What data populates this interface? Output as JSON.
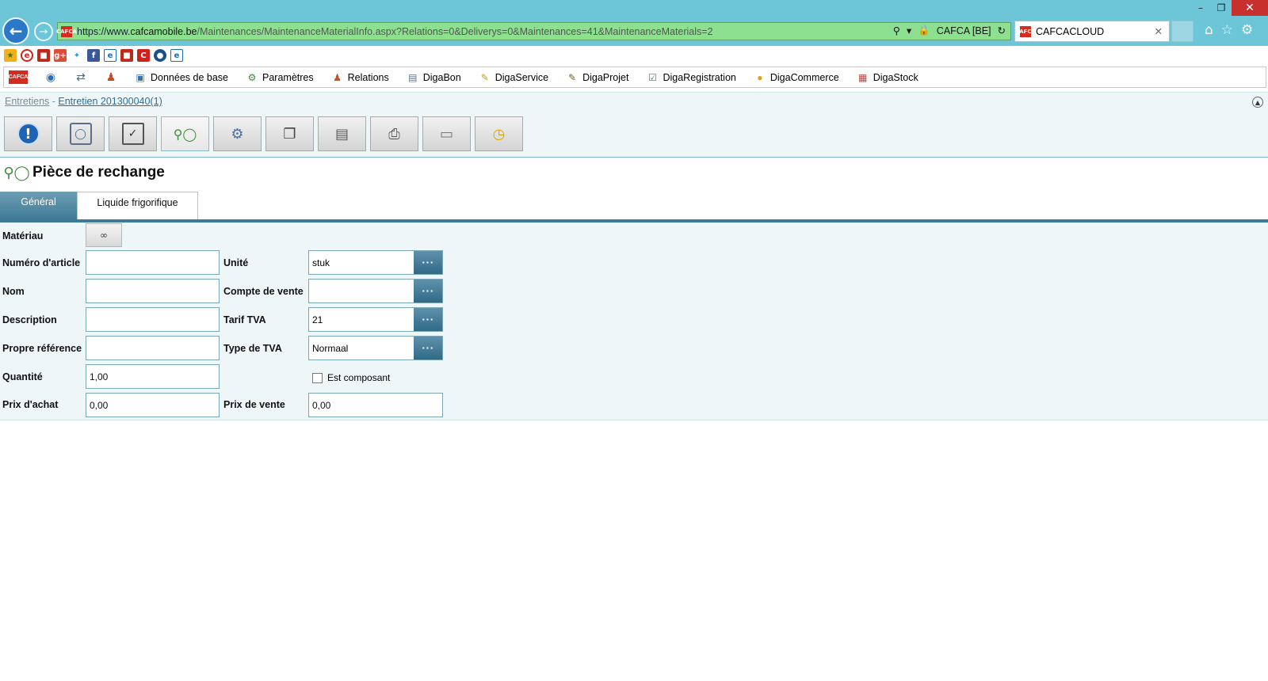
{
  "browser": {
    "url_scheme": "https://www.",
    "url_host": "cafcamobile.be",
    "url_path": "/Maintenances/MaintenanceMaterialInfo.aspx?Relations=0&Deliverys=0&Maintenances=41&MaintenanceMaterials=2",
    "site_identity": "CAFCA [BE]",
    "tab_title": "CAFCACLOUD",
    "favicon_text": "CAFCA"
  },
  "app_menu": {
    "logo_text": "CAFCA",
    "items": [
      {
        "label": "Données de base",
        "icon": "database-icon"
      },
      {
        "label": "Paramètres",
        "icon": "settings-icon"
      },
      {
        "label": "Relations",
        "icon": "people-icon"
      },
      {
        "label": "DigaBon",
        "icon": "document-icon"
      },
      {
        "label": "DigaService",
        "icon": "service-icon"
      },
      {
        "label": "DigaProjet",
        "icon": "project-icon"
      },
      {
        "label": "DigaRegistration",
        "icon": "registration-icon"
      },
      {
        "label": "DigaCommerce",
        "icon": "commerce-icon"
      },
      {
        "label": "DigaStock",
        "icon": "stock-icon"
      }
    ]
  },
  "breadcrumb": {
    "parent": "Entretiens",
    "separator": " - ",
    "current": "Entretien 201300040(1)"
  },
  "page": {
    "title": "Pièce de rechange"
  },
  "tabs": [
    "Général",
    "Liquide frigorifique"
  ],
  "form": {
    "labels": {
      "material": "Matériau",
      "article_number": "Numéro d'article",
      "name": "Nom",
      "description": "Description",
      "own_reference": "Propre référence",
      "quantity": "Quantité",
      "purchase_price": "Prix d'achat",
      "unit": "Unité",
      "sales_account": "Compte de vente",
      "vat_rate": "Tarif TVA",
      "vat_type": "Type de TVA",
      "is_component": "Est composant",
      "sale_price": "Prix de vente"
    },
    "values": {
      "article_number": "",
      "name": "",
      "description": "",
      "own_reference": "",
      "quantity": "1,00",
      "purchase_price": "0,00",
      "unit": "stuk",
      "sales_account": "",
      "vat_rate": "21",
      "vat_type": "Normaal",
      "sale_price": "0,00",
      "is_component": false
    },
    "lookup_button_label": "···"
  },
  "colors": {
    "chrome": "#6cc6d8",
    "address_bar": "#8de08f",
    "accent": "#3e7995",
    "form_bg": "#eef6f7",
    "close_button": "#c7302c"
  }
}
